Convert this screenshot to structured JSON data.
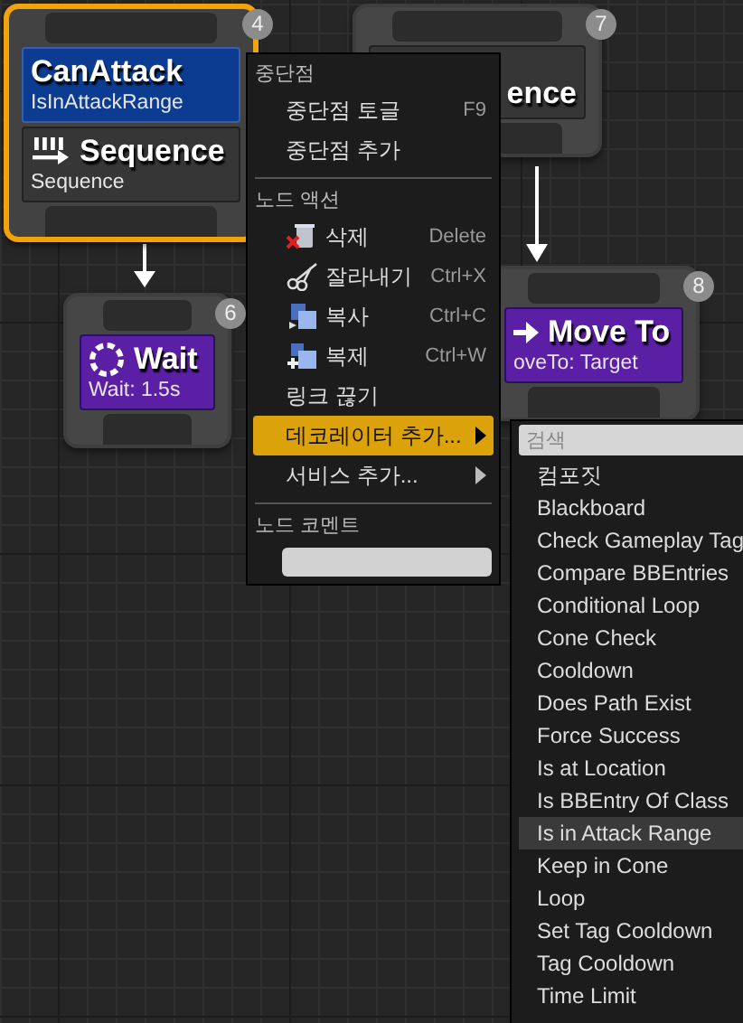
{
  "nodes": [
    {
      "badge": "4",
      "selected": true,
      "decorators": [
        {
          "title": "CanAttack",
          "subtitle": "IsInAttackRange"
        }
      ],
      "task": {
        "kind": "sequence",
        "title": "Sequence",
        "subtitle": "Sequence"
      }
    },
    {
      "badge": "7",
      "selected": false,
      "task": {
        "kind": "covered",
        "title": "ence"
      }
    },
    {
      "badge": "6",
      "selected": false,
      "task": {
        "kind": "wait",
        "title": "Wait",
        "subtitle": "Wait: 1.5s"
      }
    },
    {
      "badge": "8",
      "selected": false,
      "task": {
        "kind": "move_to",
        "title": "Move To",
        "subtitle": "oveTo: Target"
      }
    }
  ],
  "context_menu": {
    "sections": [
      {
        "kind": "items",
        "header": "중단점",
        "items": [
          {
            "label": "중단점 토글",
            "shortcut": "F9",
            "selected": false
          },
          {
            "label": "중단점 추가",
            "selected": false
          }
        ]
      },
      {
        "kind": "items",
        "header": "노드 액션",
        "items": [
          {
            "label": "삭제",
            "shortcut": "Delete",
            "selected": false
          },
          {
            "label": "잘라내기",
            "shortcut": "Ctrl+X",
            "selected": false
          },
          {
            "label": "복사",
            "shortcut": "Ctrl+C",
            "selected": false
          },
          {
            "label": "복제",
            "shortcut": "Ctrl+W",
            "selected": false
          },
          {
            "label": "링크 끊기",
            "selected": false
          },
          {
            "label": "데코레이터 추가...",
            "has_submenu": true,
            "selected": true
          },
          {
            "label": "서비스 추가...",
            "has_submenu": true,
            "selected": false
          }
        ]
      },
      {
        "kind": "comment",
        "header": "노드 코멘트"
      }
    ]
  },
  "submenu": {
    "search": {
      "placeholder": "검색"
    },
    "items": [
      {
        "label": "컴포짓",
        "selected": false
      },
      {
        "label": "Blackboard",
        "selected": false
      },
      {
        "label": "Check Gameplay Tag",
        "selected": false
      },
      {
        "label": "Compare BBEntries",
        "selected": false
      },
      {
        "label": "Conditional Loop",
        "selected": false
      },
      {
        "label": "Cone Check",
        "selected": false
      },
      {
        "label": "Cooldown",
        "selected": false
      },
      {
        "label": "Does Path Exist",
        "selected": false
      },
      {
        "label": "Force Success",
        "selected": false
      },
      {
        "label": "Is at Location",
        "selected": false
      },
      {
        "label": "Is BBEntry Of Class",
        "selected": false
      },
      {
        "label": "Is in Attack Range",
        "selected": true
      },
      {
        "label": "Keep in Cone",
        "selected": false
      },
      {
        "label": "Loop",
        "selected": false
      },
      {
        "label": "Set Tag Cooldown",
        "selected": false
      },
      {
        "label": "Tag Cooldown",
        "selected": false
      },
      {
        "label": "Time Limit",
        "selected": false
      }
    ]
  }
}
